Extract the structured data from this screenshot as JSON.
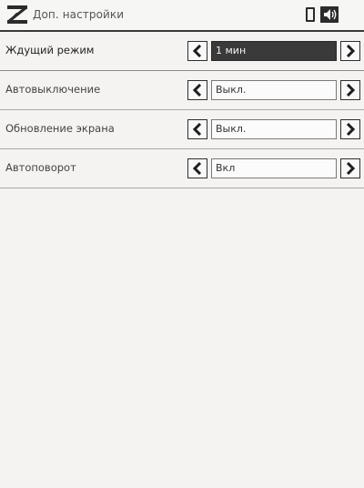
{
  "header": {
    "title": "Доп. настройки",
    "logo_icon": "app-logo-icon",
    "battery_icon": "battery-icon",
    "sound_icon": "sound-icon"
  },
  "settings": [
    {
      "label": "Ждущий режим",
      "value": "1 мин",
      "selected": true
    },
    {
      "label": "Автовыключение",
      "value": "Выкл.",
      "selected": false
    },
    {
      "label": "Обновление экрана",
      "value": "Выкл.",
      "selected": false
    },
    {
      "label": "Автоповорот",
      "value": "Вкл",
      "selected": false
    }
  ],
  "colors": {
    "background": "#f4f3f2",
    "divider": "#3a3a3a",
    "selected_value_bg": "#3a3a3a"
  }
}
